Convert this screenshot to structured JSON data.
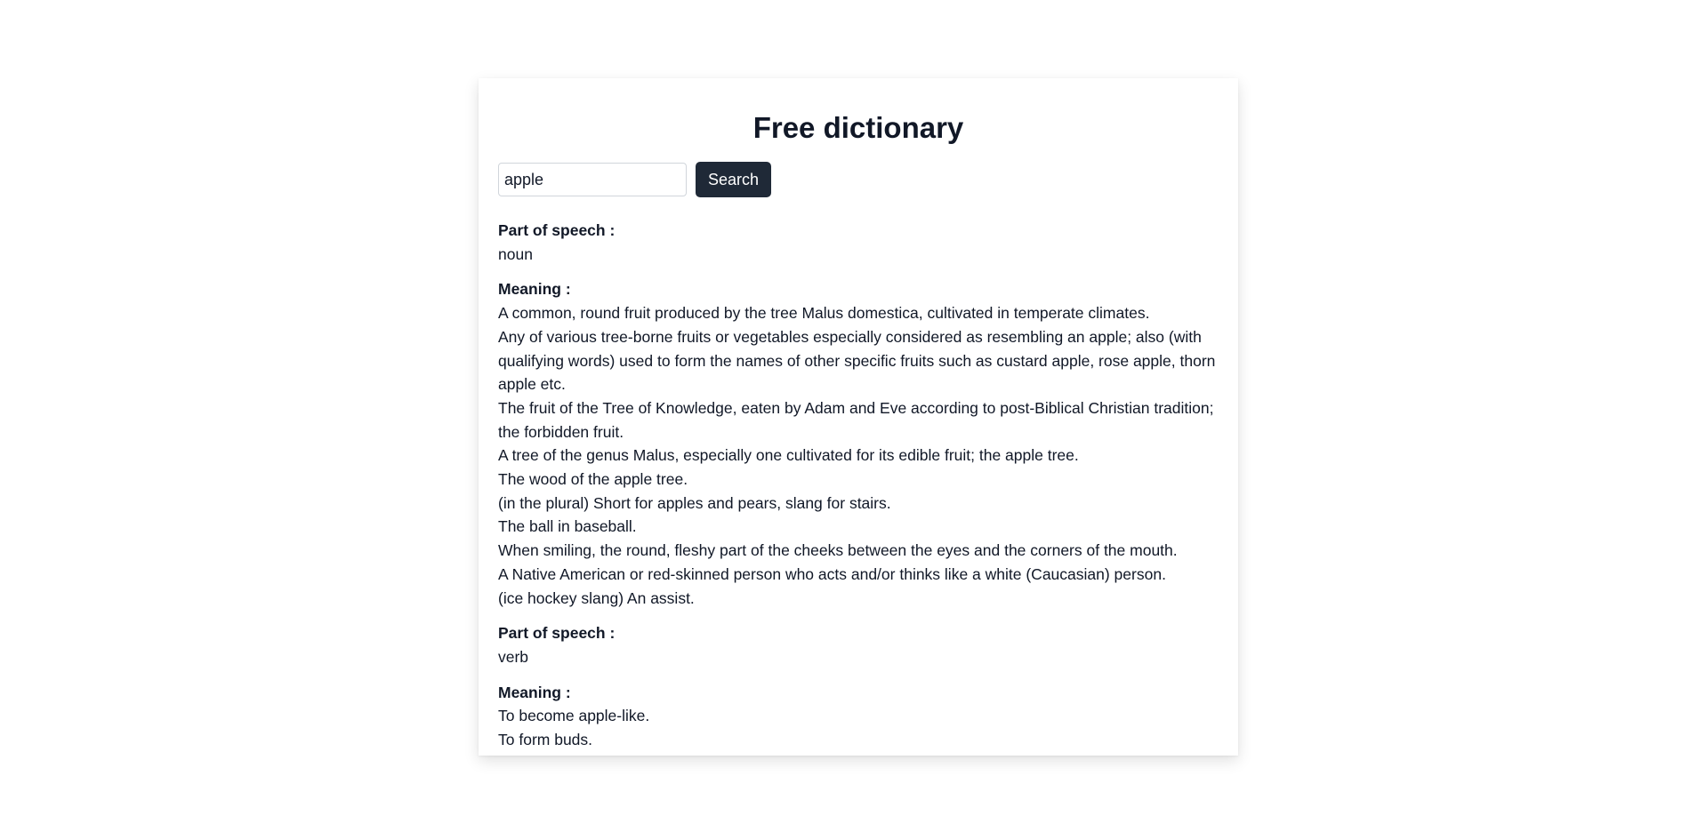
{
  "app": {
    "title": "Free dictionary"
  },
  "search": {
    "value": "apple",
    "button_label": "Search"
  },
  "entries": [
    {
      "pos_label": "Part of speech :",
      "pos": "noun",
      "meaning_label": "Meaning :",
      "meanings": [
        "A common, round fruit produced by the tree Malus domestica, cultivated in temperate climates.",
        "Any of various tree-borne fruits or vegetables especially considered as resembling an apple; also (with qualifying words) used to form the names of other specific fruits such as custard apple, rose apple, thorn apple etc.",
        "The fruit of the Tree of Knowledge, eaten by Adam and Eve according to post-Biblical Christian tradition; the forbidden fruit.",
        "A tree of the genus Malus, especially one cultivated for its edible fruit; the apple tree.",
        "The wood of the apple tree.",
        "(in the plural) Short for apples and pears, slang for stairs.",
        "The ball in baseball.",
        "When smiling, the round, fleshy part of the cheeks between the eyes and the corners of the mouth.",
        "A Native American or red-skinned person who acts and/or thinks like a white (Caucasian) person.",
        "(ice hockey slang) An assist."
      ]
    },
    {
      "pos_label": "Part of speech :",
      "pos": "verb",
      "meaning_label": "Meaning :",
      "meanings": [
        "To become apple-like.",
        "To form buds."
      ]
    }
  ],
  "colors": {
    "button_bg": "#1f2937",
    "text": "#111827"
  }
}
